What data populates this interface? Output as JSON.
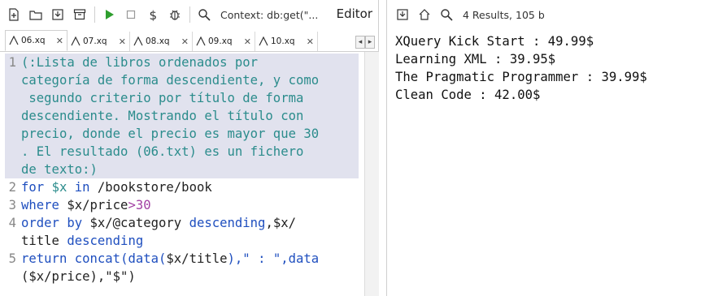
{
  "toolbar": {
    "context": "Context: db:get(\"...",
    "mode": "Editor",
    "icons": [
      "new-file-icon",
      "open-icon",
      "save-icon",
      "archive-icon",
      "run-icon",
      "stop-icon",
      "dollar-icon",
      "debug-icon",
      "search-icon"
    ]
  },
  "tabs": [
    {
      "label": "06.xq",
      "active": true
    },
    {
      "label": "07.xq",
      "active": false
    },
    {
      "label": "08.xq",
      "active": false
    },
    {
      "label": "09.xq",
      "active": false
    },
    {
      "label": "10.xq",
      "active": false
    }
  ],
  "code": {
    "gutter": [
      "1",
      "2",
      "3",
      "4",
      "5"
    ],
    "comment_lines": [
      "(:Lista de libros ordenados por",
      "categoría de forma descendiente, y como",
      " segundo criterio por título de forma",
      "descendiente. Mostrando el título con",
      "precio, donde el precio es mayor que 30",
      ". El resultado (06.txt) es un fichero",
      "de texto:)"
    ],
    "line2": {
      "kw_for": "for",
      "var": "$x",
      "kw_in": "in",
      "path": "/bookstore/book"
    },
    "line3": {
      "kw_where": "where",
      "expr": "$x/price",
      "op": ">",
      "num": "30"
    },
    "line4": {
      "kw_order": "order by",
      "expr1": "$x/@category",
      "kw_desc": "descending",
      "sep": ",",
      "expr2": "$x/"
    },
    "line4b": {
      "expr": "title",
      "kw_desc": "descending"
    },
    "line5": {
      "kw_return": "return",
      "fn": "concat(data(",
      "var": "$x/title",
      "rest": "),\" : \",data"
    },
    "line5b": {
      "text": "($x/price),\"$\")"
    }
  },
  "results": {
    "info": "4 Results, 105 b",
    "lines": [
      "XQuery Kick Start : 49.99$",
      "Learning XML : 39.95$",
      "The Pragmatic Programmer : 39.99$",
      "Clean Code : 42.00$"
    ]
  },
  "colors": {
    "comment_bg": "#e1e2ee",
    "comment": "#2b8c8c",
    "keyword": "#1f4fbf",
    "number": "#a23fa3",
    "run_green": "#2e9e2e"
  }
}
